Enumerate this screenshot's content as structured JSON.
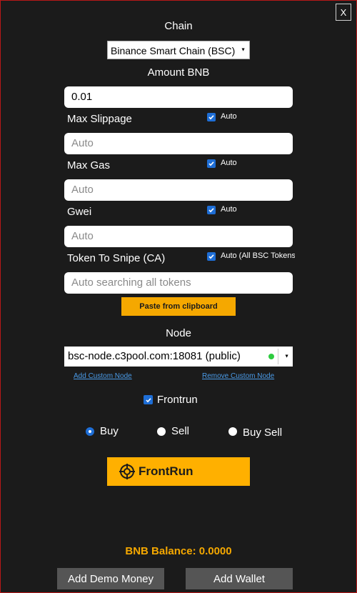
{
  "window": {
    "close_label": "X"
  },
  "chain": {
    "label": "Chain",
    "selected": "Binance Smart Chain (BSC)"
  },
  "amount": {
    "label": "Amount BNB",
    "value": "0.01"
  },
  "slippage": {
    "label": "Max Slippage",
    "checkbox_label": "Auto",
    "placeholder": "Auto"
  },
  "gas": {
    "label": "Max Gas",
    "checkbox_label": "Auto",
    "placeholder": "Auto"
  },
  "gwei": {
    "label": "Gwei",
    "checkbox_label": "Auto",
    "placeholder": "Auto"
  },
  "token": {
    "label": "Token To Snipe (CA)",
    "checkbox_label": "Auto (All BSC Tokens",
    "placeholder": "Auto searching all tokens"
  },
  "paste_button": "Paste from clipboard",
  "node": {
    "label": "Node",
    "selected": "bsc-node.c3pool.com:18081 (public)",
    "status_color": "#2ecc40",
    "add_link": "Add Custom Node",
    "remove_link": "Remove Custom Node"
  },
  "frontrun_checkbox": {
    "label": "Frontrun",
    "checked": true
  },
  "mode": {
    "options": [
      "Buy",
      "Sell",
      "Buy Sell"
    ],
    "selected": "Buy"
  },
  "frontrun_button": {
    "label": "FrontRun",
    "icon": "crosshair-icon"
  },
  "balance": "BNB Balance: 0.0000",
  "buttons": {
    "demo": "Add Demo Money",
    "wallet": "Add Wallet"
  },
  "colors": {
    "accent": "#ffb000",
    "background": "#1b1b1b",
    "border": "#b81818",
    "check": "#1e6ed6"
  }
}
